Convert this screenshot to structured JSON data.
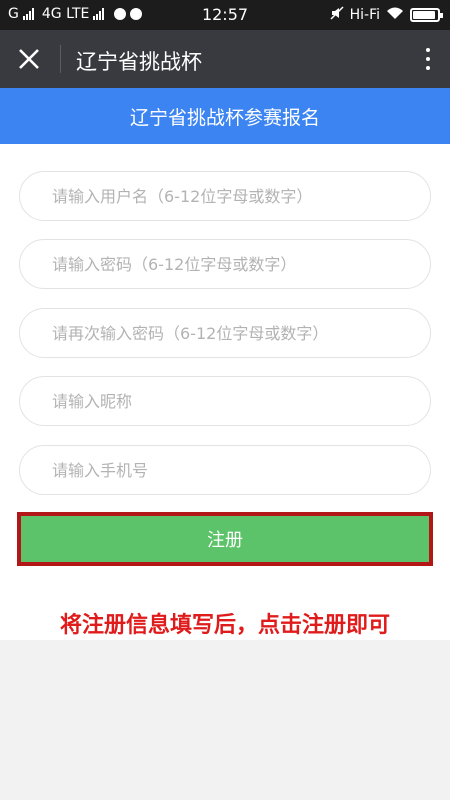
{
  "status_bar": {
    "carrier_g": "G",
    "network": "4G LTE",
    "time": "12:57",
    "wifi_label": "Hi-Fi",
    "battery_level": 0.9
  },
  "title_bar": {
    "title": "辽宁省挑战杯"
  },
  "banner": {
    "text": "辽宁省挑战杯参赛报名"
  },
  "form": {
    "username_placeholder": "请输入用户名（6-12位字母或数字）",
    "password_placeholder": "请输入密码（6-12位字母或数字）",
    "confirm_placeholder": "请再次输入密码（6-12位字母或数字）",
    "nickname_placeholder": "请输入昵称",
    "phone_placeholder": "请输入手机号",
    "register_label": "注册"
  },
  "instruction": "将注册信息填写后，点击注册即可",
  "colors": {
    "banner": "#3b84f2",
    "button": "#5cc36a",
    "highlight": "#b31616",
    "instruction": "#e01b1b"
  }
}
